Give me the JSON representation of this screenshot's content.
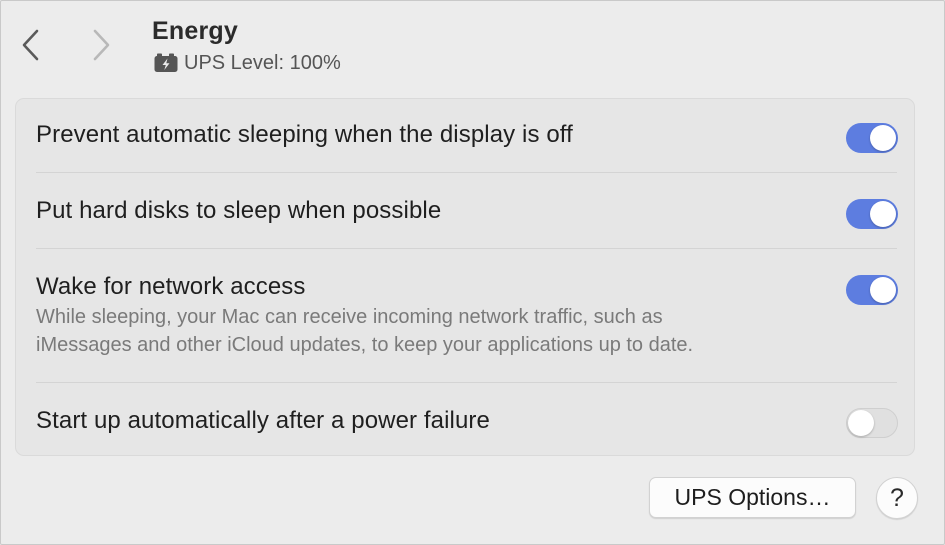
{
  "header": {
    "title": "Energy",
    "subtitle": "UPS Level: 100%",
    "subtitle_icon": "battery-charging-icon"
  },
  "navigation": {
    "back_icon": "chevron-left-icon",
    "forward_icon": "chevron-right-icon"
  },
  "settings": [
    {
      "label": "Prevent automatic sleeping when the display is off",
      "enabled": true
    },
    {
      "label": "Put hard disks to sleep when possible",
      "enabled": true
    },
    {
      "label": "Wake for network access",
      "description_line1": "While sleeping, your Mac can receive incoming network traffic, such as",
      "description_line2": "iMessages and other iCloud updates, to keep your applications up to date.",
      "enabled": true
    },
    {
      "label": "Start up automatically after a power failure",
      "enabled": false
    }
  ],
  "footer": {
    "ups_options_label": "UPS Options…",
    "help_label": "?"
  },
  "colors": {
    "toggle_on": "#5d7de0",
    "toggle_off": "#e0e0e0",
    "background": "#ececec"
  }
}
